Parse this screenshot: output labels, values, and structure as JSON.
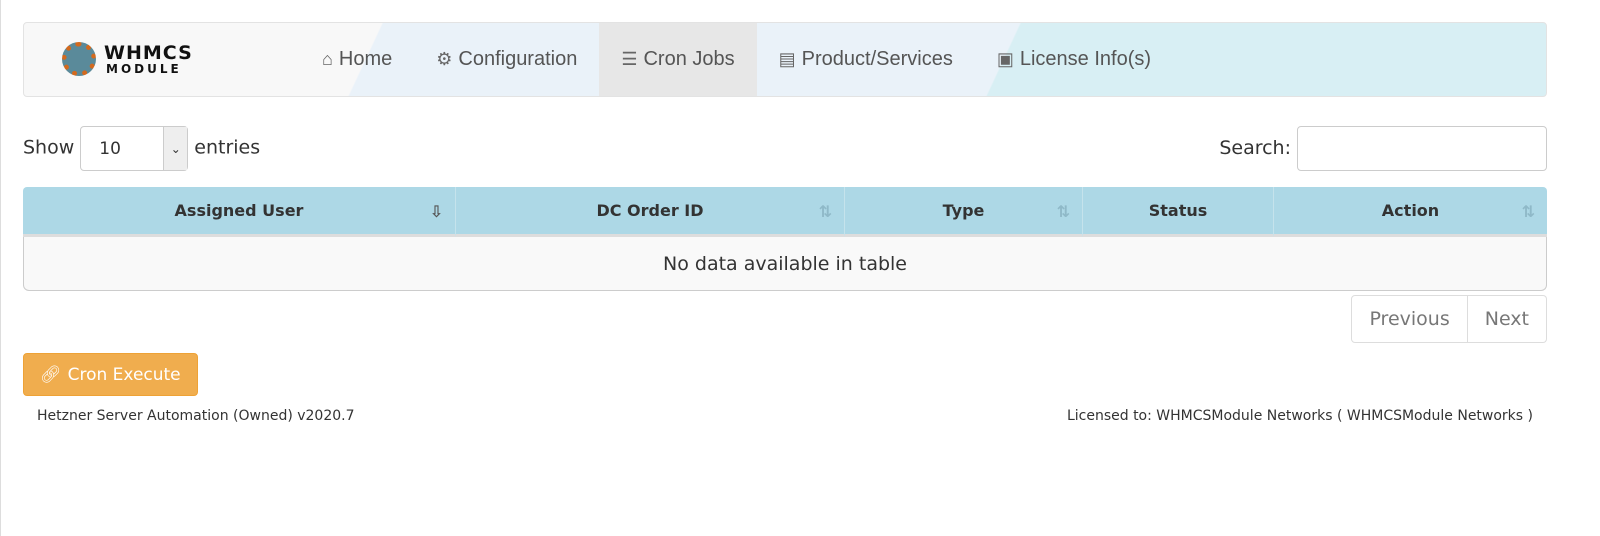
{
  "logo": {
    "text1": "WHMCS",
    "text2": "MODULE"
  },
  "nav": [
    {
      "icon": "home-icon",
      "glyph": "⌂",
      "label": "Home"
    },
    {
      "icon": "gears-icon",
      "glyph": "⚙",
      "label": "Configuration"
    },
    {
      "icon": "list-check-icon",
      "glyph": "☰",
      "label": "Cron Jobs",
      "active": true
    },
    {
      "icon": "server-icon",
      "glyph": "▤",
      "label": "Product/Services"
    },
    {
      "icon": "id-card-icon",
      "glyph": "▣",
      "label": "License Info(s)"
    }
  ],
  "controls": {
    "show": "Show",
    "entries_value": "10",
    "entries": "entries",
    "search_label": "Search:",
    "search_value": ""
  },
  "table": {
    "headers": [
      "Assigned User",
      "DC Order ID",
      "Type",
      "Status",
      "Action"
    ],
    "empty": "No data available in table"
  },
  "pager": {
    "previous": "Previous",
    "next": "Next"
  },
  "button": {
    "label": "Cron Execute",
    "color": "#f0ad4e"
  },
  "footer": {
    "left": "Hetzner Server Automation (Owned) v2020.7",
    "right": "Licensed to: WHMCSModule Networks ( WHMCSModule Networks )"
  }
}
